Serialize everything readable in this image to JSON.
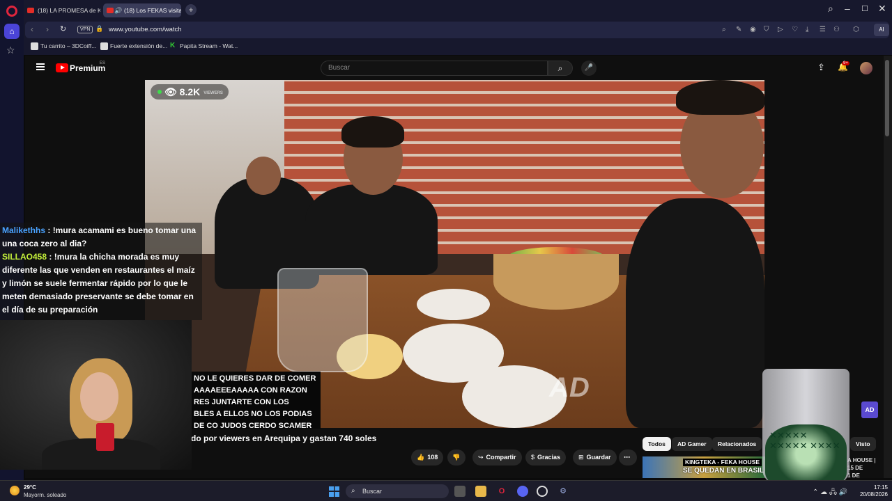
{
  "browser": {
    "tabs": [
      {
        "title": "(18) LA PROMESA de King"
      },
      {
        "title": "(18) Los FEKAS visitan"
      }
    ],
    "url": "www.youtube.com/watch",
    "vpn_label": "VPN",
    "ai_label": "AI",
    "bookmarks": [
      {
        "label": "Tu carrito – 3DCoiff..."
      },
      {
        "label": "Fuerte extensión de..."
      },
      {
        "label": "Papita Stream - Wat..."
      }
    ]
  },
  "youtube": {
    "brand": "Premium",
    "region": "ES",
    "search_placeholder": "Buscar",
    "notification_badge": "9+",
    "viewers_count": "8.2K",
    "viewers_label": "VIEWERS",
    "watermark": "AD",
    "video_title": "do por viewers en Arequipa y gastan 740 soles",
    "actions": {
      "likes": "108",
      "share": "Compartir",
      "thanks": "Gracias",
      "save": "Guardar"
    },
    "chips": [
      "Todos",
      "AD Gamer",
      "Relacionados",
      "Visto"
    ],
    "related": {
      "title_line": "KINGTEKA - FEKA HOUSE",
      "title_sub": "SE QUEDAN EN BRASIL",
      "side_line1": "A HOUSE |",
      "side_line2": "15 DE",
      "side_line3": "1 DE"
    },
    "ad_logo": "AD"
  },
  "overlay": {
    "chat": [
      {
        "user": "Malikethhs",
        "message": ": !mura acamami es bueno tomar una una coca zero al dia?"
      },
      {
        "user": "SILLAO458",
        "message": ": !mura la chicha morada es muy diferente las que venden en restaurantes el maíz y limón se suele fermentar rápido por lo que le meten demasiado preservante se debe tomar en el día de su preparación"
      }
    ],
    "ticker": [
      "NO LE QUIERES DAR DE COMER",
      "AAAAEEEAAAAA CON RAZON",
      "RES JUNTARTE CON LOS",
      "BLES A ELLOS NO LOS PODIAS",
      "DE CO JUDOS CERDO SCAMER"
    ]
  },
  "taskbar": {
    "temperature": "29°C",
    "condition": "Mayorm. soleado",
    "search": "Buscar",
    "time": "17:15",
    "date": "20/08/2026"
  },
  "colors": {
    "yt_red": "#ff0000",
    "opera_red": "#e0253d",
    "chat_user1": "#4aa3ff",
    "chat_user2": "#c4f03a",
    "viewer_dot": "#3ddc4a"
  }
}
